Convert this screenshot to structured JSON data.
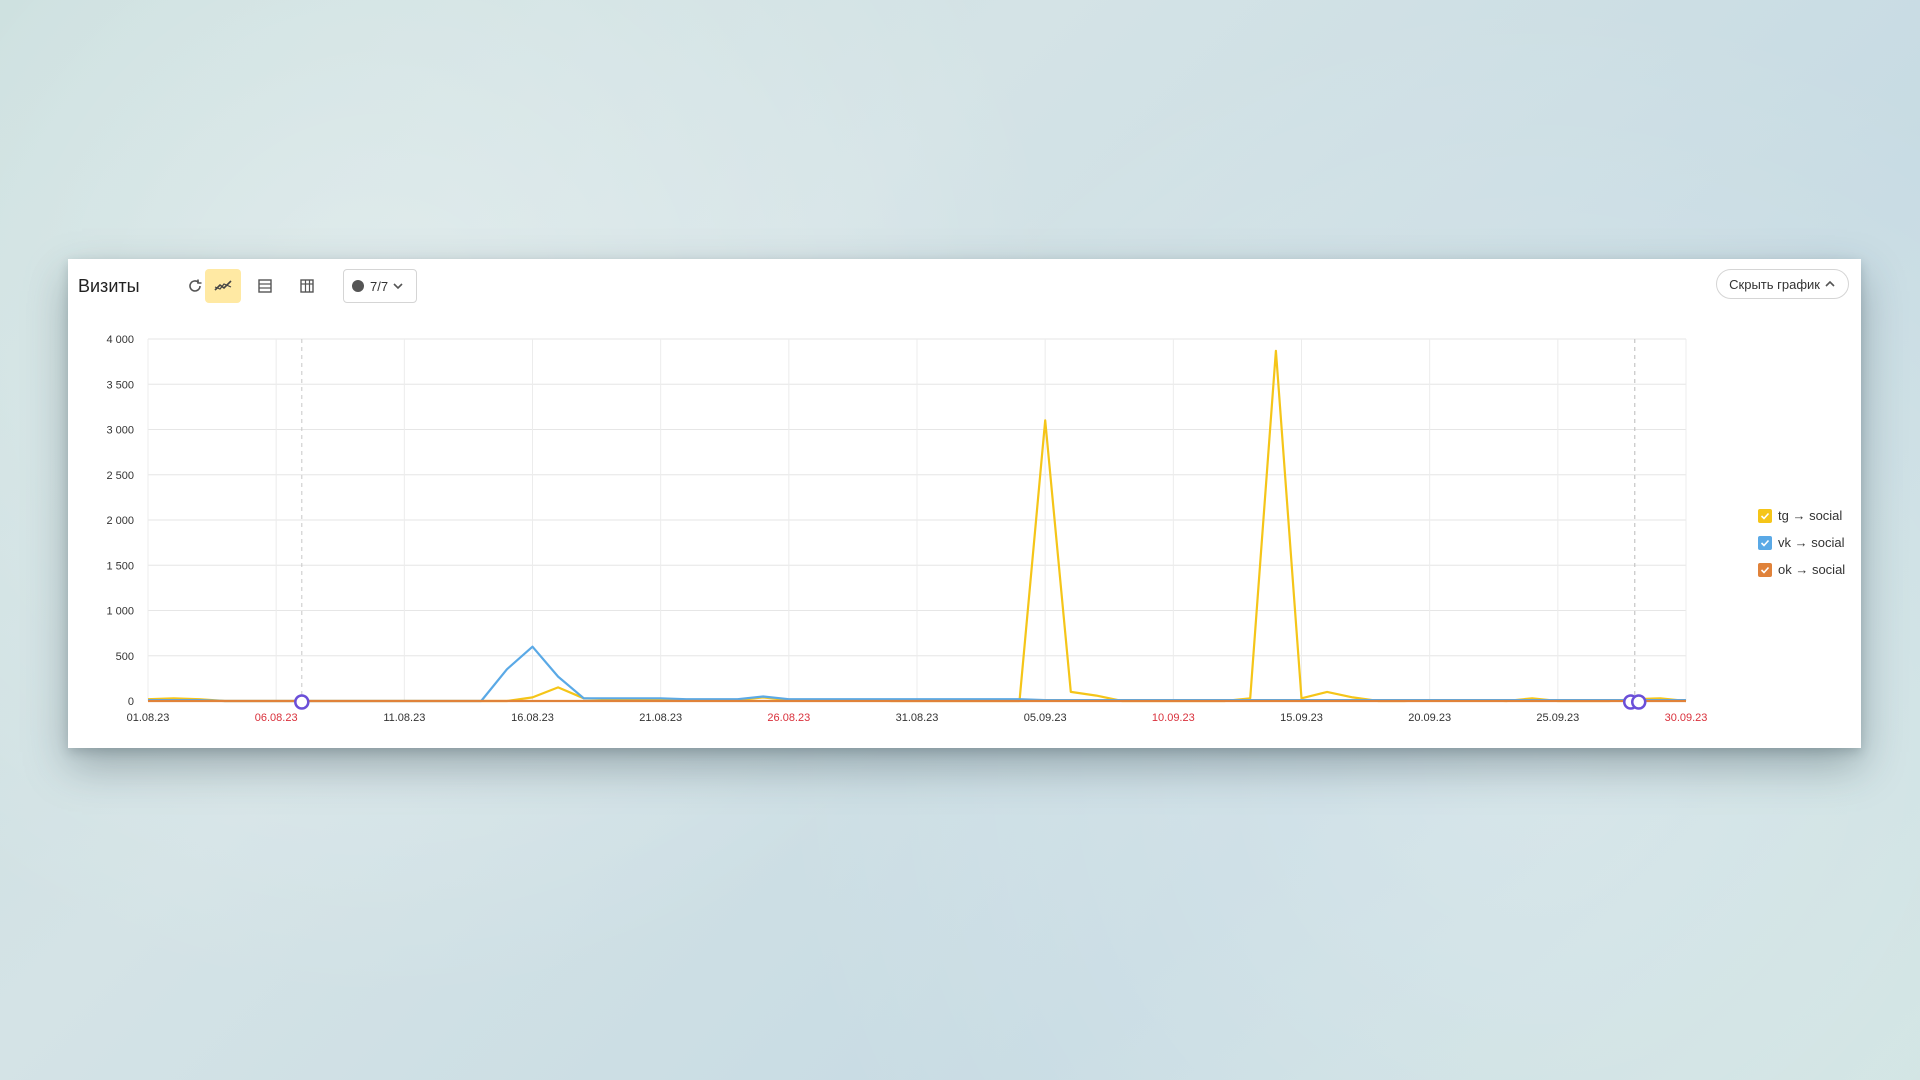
{
  "toolbar": {
    "title": "Визиты",
    "attributes_label": "7/7",
    "hide_chart_label": "Скрыть график"
  },
  "colors": {
    "accent": "#ffe9a3",
    "weekend_tick": "#d9303b",
    "regular_tick": "#333333",
    "annotation": "#6b4fd8"
  },
  "icons": [
    "refresh-icon",
    "line-chart-icon",
    "stacked-area-icon",
    "table-icon",
    "attributes-icon",
    "chevron-down-icon",
    "chevron-up-icon"
  ],
  "chart_data": {
    "type": "line",
    "title": "",
    "xlabel": "",
    "ylabel": "",
    "ylim": [
      0,
      4000
    ],
    "y_ticks": [
      "4 000",
      "3 500",
      "3 000",
      "2 500",
      "2 000",
      "1 500",
      "1 000",
      "500",
      "0"
    ],
    "x_ticks": [
      {
        "label": "01.08.23",
        "weekend": false
      },
      {
        "label": "06.08.23",
        "weekend": true
      },
      {
        "label": "11.08.23",
        "weekend": false
      },
      {
        "label": "16.08.23",
        "weekend": false
      },
      {
        "label": "21.08.23",
        "weekend": false
      },
      {
        "label": "26.08.23",
        "weekend": true
      },
      {
        "label": "31.08.23",
        "weekend": false
      },
      {
        "label": "05.09.23",
        "weekend": false
      },
      {
        "label": "10.09.23",
        "weekend": true
      },
      {
        "label": "15.09.23",
        "weekend": false
      },
      {
        "label": "20.09.23",
        "weekend": false
      },
      {
        "label": "25.09.23",
        "weekend": false
      },
      {
        "label": "30.09.23",
        "weekend": true
      }
    ],
    "x": [
      "01.08",
      "02.08",
      "03.08",
      "04.08",
      "05.08",
      "06.08",
      "07.08",
      "08.08",
      "09.08",
      "10.08",
      "11.08",
      "12.08",
      "13.08",
      "14.08",
      "15.08",
      "16.08",
      "17.08",
      "18.08",
      "19.08",
      "20.08",
      "21.08",
      "22.08",
      "23.08",
      "24.08",
      "25.08",
      "26.08",
      "27.08",
      "28.08",
      "29.08",
      "30.08",
      "31.08",
      "01.09",
      "02.09",
      "03.09",
      "04.09",
      "05.09",
      "06.09",
      "07.09",
      "08.09",
      "09.09",
      "10.09",
      "11.09",
      "12.09",
      "13.09",
      "14.09",
      "15.09",
      "16.09",
      "17.09",
      "18.09",
      "19.09",
      "20.09",
      "21.09",
      "22.09",
      "23.09",
      "24.09",
      "25.09",
      "26.09",
      "27.09",
      "28.09",
      "29.09",
      "30.09"
    ],
    "series": [
      {
        "name": "tg → social",
        "color": "#f5c518",
        "values": [
          20,
          30,
          20,
          0,
          0,
          0,
          0,
          0,
          0,
          0,
          0,
          0,
          0,
          0,
          0,
          40,
          150,
          30,
          20,
          10,
          10,
          10,
          10,
          10,
          40,
          10,
          10,
          10,
          10,
          0,
          0,
          0,
          0,
          0,
          0,
          3100,
          100,
          60,
          0,
          0,
          0,
          0,
          0,
          30,
          3870,
          30,
          100,
          40,
          0,
          0,
          10,
          10,
          10,
          0,
          30,
          0,
          0,
          0,
          20,
          30,
          0
        ]
      },
      {
        "name": "vk → social",
        "color": "#5aa9e6",
        "values": [
          10,
          10,
          10,
          0,
          0,
          0,
          0,
          0,
          0,
          0,
          0,
          0,
          0,
          0,
          350,
          600,
          270,
          30,
          30,
          30,
          30,
          20,
          20,
          20,
          50,
          20,
          20,
          20,
          20,
          20,
          20,
          20,
          20,
          20,
          20,
          10,
          10,
          10,
          10,
          10,
          10,
          10,
          10,
          10,
          10,
          10,
          10,
          10,
          10,
          10,
          10,
          10,
          10,
          10,
          10,
          10,
          10,
          10,
          10,
          10,
          10
        ]
      },
      {
        "name": "ok → social",
        "color": "#e0823a",
        "values": [
          0,
          0,
          0,
          0,
          0,
          0,
          0,
          0,
          0,
          0,
          0,
          0,
          0,
          0,
          0,
          0,
          0,
          0,
          0,
          0,
          0,
          0,
          0,
          0,
          0,
          0,
          0,
          0,
          0,
          0,
          0,
          0,
          0,
          0,
          0,
          0,
          0,
          0,
          0,
          0,
          0,
          0,
          0,
          0,
          0,
          0,
          0,
          0,
          0,
          0,
          0,
          0,
          0,
          0,
          0,
          0,
          0,
          0,
          0,
          0,
          0
        ]
      }
    ],
    "annotations": [
      {
        "x": "07.08"
      },
      {
        "x": "28.09"
      },
      {
        "x": "28.09"
      }
    ],
    "grid": true,
    "legend_position": "right"
  }
}
